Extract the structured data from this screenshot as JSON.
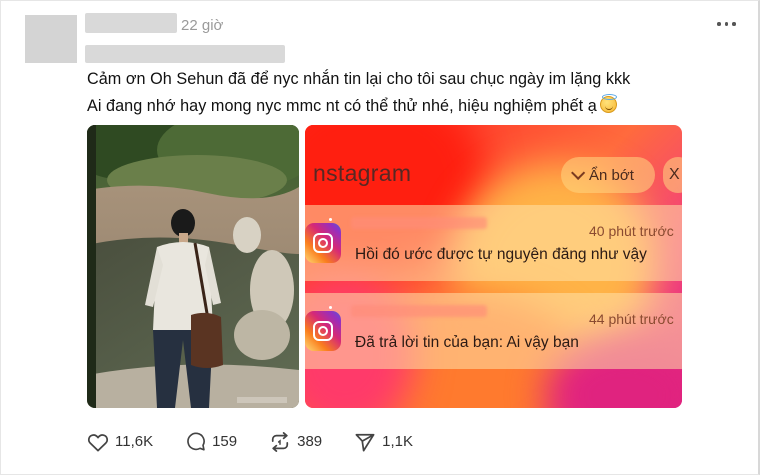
{
  "post": {
    "time": "22 giờ",
    "lines": [
      "Cảm ơn Oh Sehun đã để nyc nhắn tin lại cho tôi sau chục ngày im lặng kkk",
      "Ai đang nhớ hay mong nyc mmc nt có thể thử nhé, hiệu nghiệm phết ạ"
    ],
    "emoji": "smiling-face-with-halo"
  },
  "screenshot": {
    "app_title": "nstagram",
    "collapse_label": "Ẩn bớt",
    "close_glyph": "X",
    "notifications": [
      {
        "time": "40 phút trước",
        "message": "Hồi đó ước được tự nguyện đăng như vậy"
      },
      {
        "time": "44 phút trước",
        "message": "Đã trả lời tin của bạn: Ai vậy bạn"
      }
    ]
  },
  "actions": {
    "likes": "11,6K",
    "comments": "159",
    "reposts": "389",
    "shares": "1,1K"
  },
  "colors": {
    "muted_text": "#9a9a9a",
    "icon": "#444444"
  }
}
